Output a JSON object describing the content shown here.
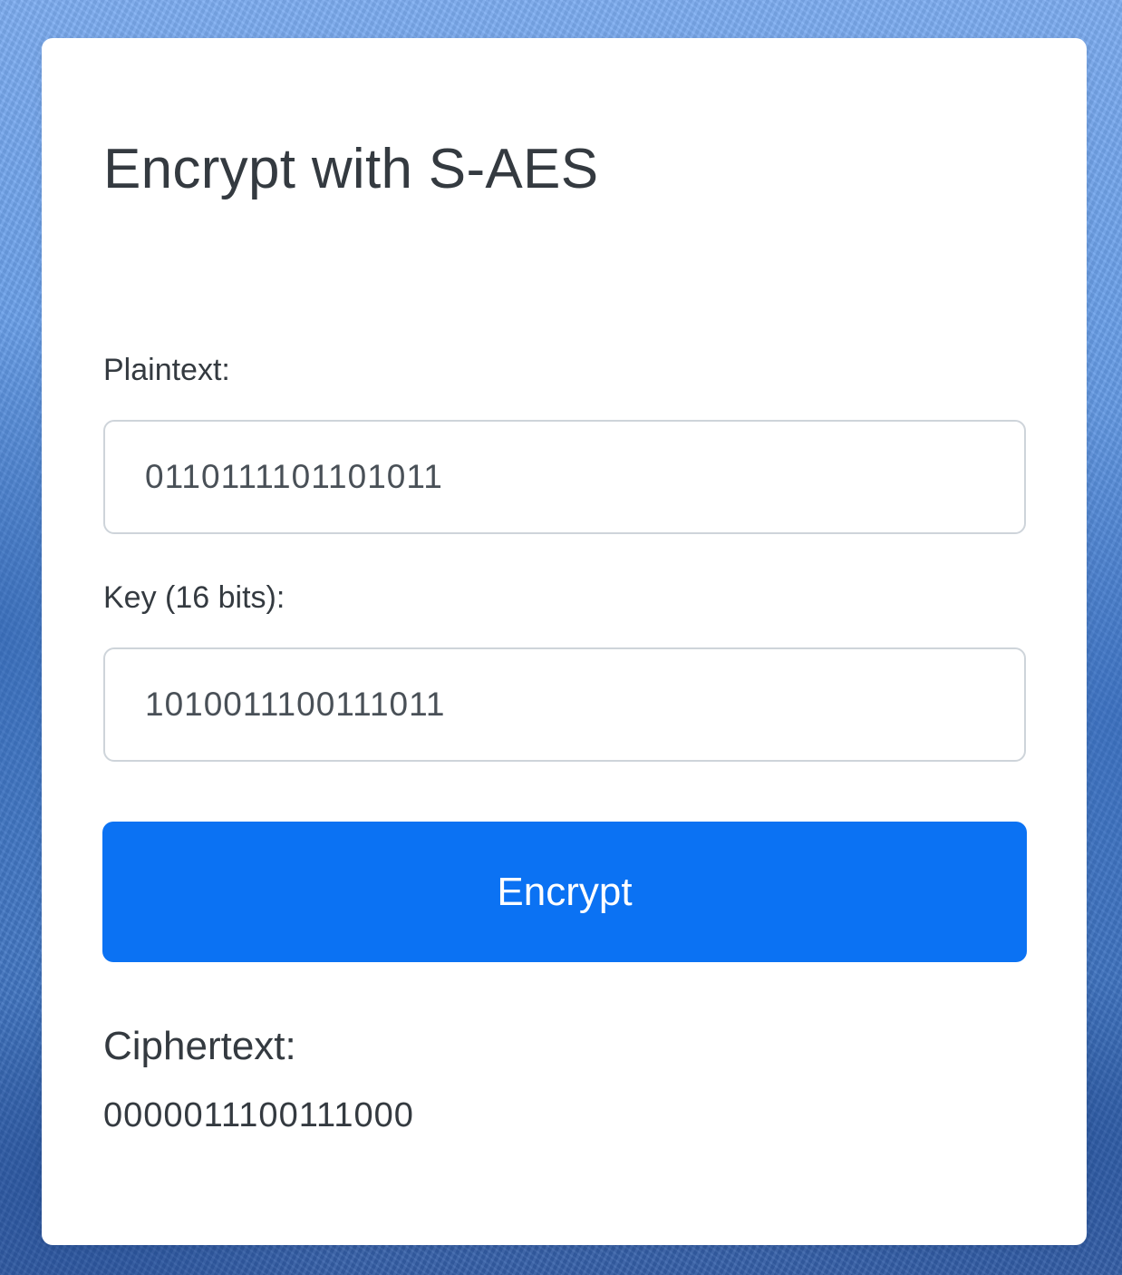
{
  "card": {
    "title": "Encrypt with S-AES"
  },
  "form": {
    "plaintext_label": "Plaintext:",
    "plaintext_value": "0110111101101011",
    "key_label": "Key (16 bits):",
    "key_value": "1010011100111011",
    "submit_label": "Encrypt"
  },
  "result": {
    "heading": "Ciphertext:",
    "value": "0000011100111000"
  },
  "colors": {
    "accent": "#0b72f3",
    "text": "#343a40",
    "input_border": "#ced4da"
  }
}
